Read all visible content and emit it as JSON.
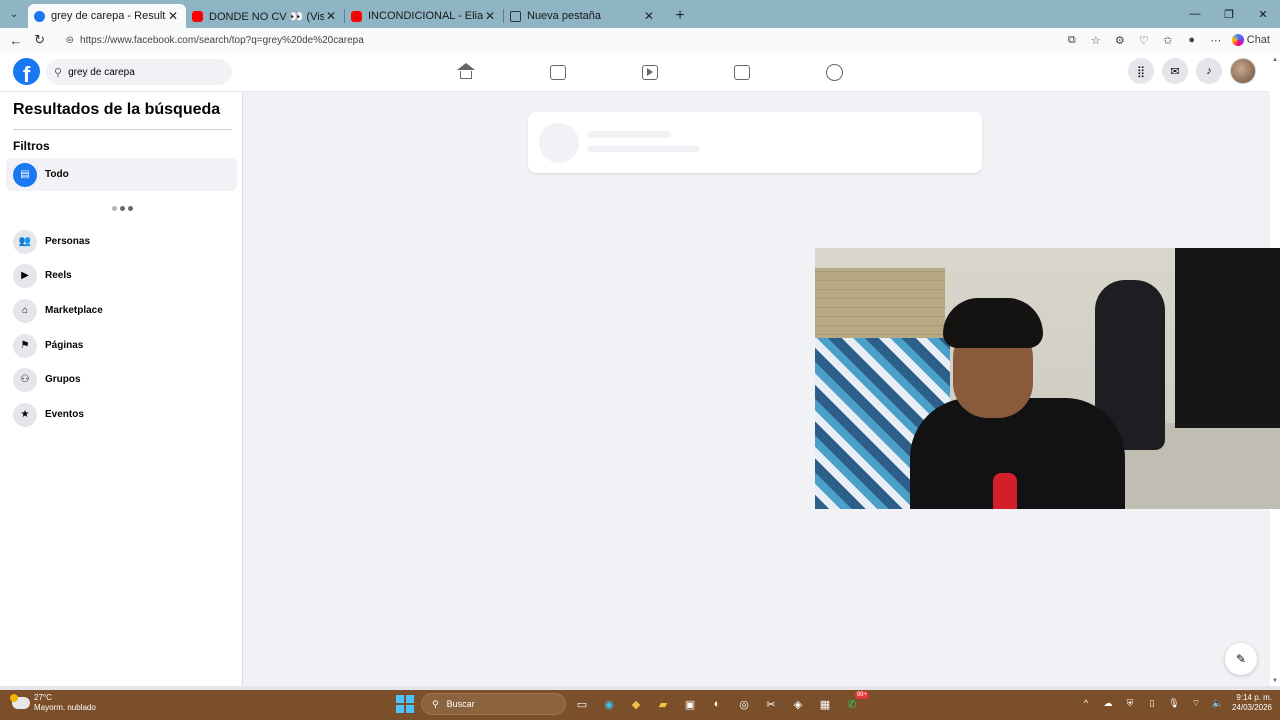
{
  "browser": {
    "tabs": [
      {
        "title": "grey de carepa - Resultados de bú",
        "favicon": "facebook-icon",
        "active": true
      },
      {
        "title": "DONDE NO CV 👀 (Visualizer) | Jo",
        "favicon": "youtube-icon",
        "active": false
      },
      {
        "title": "INCONDICIONAL - Elian Barrios Ft",
        "favicon": "youtube-icon",
        "active": false
      },
      {
        "title": "Nueva pestaña",
        "favicon": "newtab-icon",
        "active": false
      }
    ],
    "url": "https://www.facebook.com/search/top?q=grey%20de%20carepa",
    "chat_label": "Chat"
  },
  "facebook": {
    "logo_letter": "f",
    "search_value": "grey de carepa",
    "brand_color": "#1877f2"
  },
  "sidebar": {
    "title": "Resultados de la búsqueda",
    "filters_label": "Filtros",
    "items": [
      {
        "label": "Todo",
        "icon": "feed-icon",
        "active": true
      },
      {
        "label": "Personas",
        "icon": "people-icon",
        "active": false
      },
      {
        "label": "Reels",
        "icon": "reels-icon",
        "active": false
      },
      {
        "label": "Marketplace",
        "icon": "marketplace-icon",
        "active": false
      },
      {
        "label": "Páginas",
        "icon": "flag-icon",
        "active": false
      },
      {
        "label": "Grupos",
        "icon": "groups-icon",
        "active": false
      },
      {
        "label": "Eventos",
        "icon": "calendar-star-icon",
        "active": false
      }
    ]
  },
  "taskbar": {
    "weather_temp": "27°C",
    "weather_desc": "Mayorm. nublado",
    "search_label": "Buscar",
    "notification_badge": "99+",
    "time": "9:14 p. m.",
    "date": "24/03/2026"
  }
}
